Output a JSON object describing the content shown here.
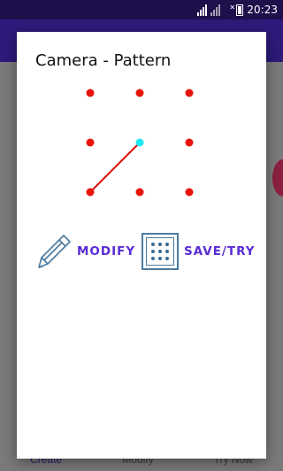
{
  "statusbar": {
    "time": "20:23"
  },
  "bottom_nav": {
    "items": [
      "Create",
      "Modify",
      "Try Now"
    ]
  },
  "dialog": {
    "title": "Camera - Pattern",
    "actions": {
      "modify_label": "MODIFY",
      "save_label": "SAVE/TRY"
    }
  },
  "pattern": {
    "dot_color": "#e8140a",
    "active_dot_color": "#1ee8f0",
    "line_color": "#d81010",
    "grid": "3x3",
    "selected_sequence": [
      5,
      7
    ],
    "active_dot": 5
  },
  "icons": {
    "pencil": "pencil-icon",
    "grid": "pattern-grid-icon"
  }
}
